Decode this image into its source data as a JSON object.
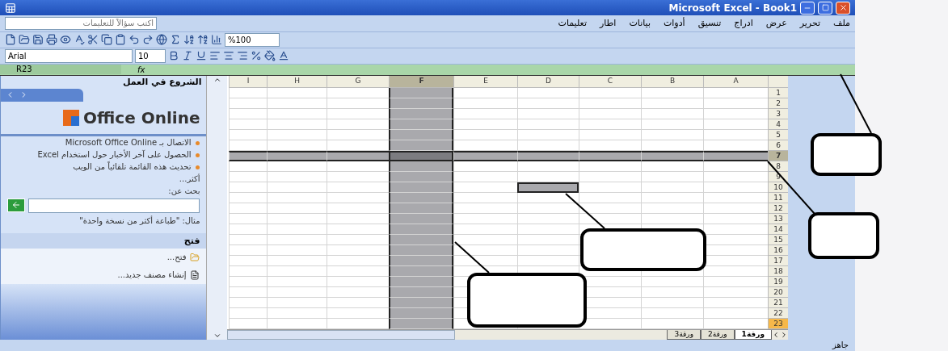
{
  "window": {
    "title": "Microsoft Excel - Book1"
  },
  "menu": {
    "items": [
      "ملف",
      "تحرير",
      "عرض",
      "ادراج",
      "تنسيق",
      "أدوات",
      "بيانات",
      "اطار",
      "تعليمات"
    ],
    "help_placeholder": "اكتب سؤالاً للتعليمات"
  },
  "standard_toolbar": {
    "zoom": "%100"
  },
  "formatting_toolbar": {
    "font": "Arial",
    "size": "10"
  },
  "formula_bar": {
    "name_box": "R23",
    "fx_label": "fx"
  },
  "task_pane": {
    "title": "الشروع في العمل",
    "logo_text": "Office Online",
    "links": [
      "الاتصال بـ Microsoft Office Online",
      "الحصول على آخر الأخبار حول استخدام Excel",
      "تحديث هذه القائمة تلقائياً من الويب"
    ],
    "more": "أكثر...",
    "search_label": "بحث عن:",
    "example": "مثال: \"طباعة أكثر من نسخة واحدة\"",
    "open_title": "فتح",
    "open_items": [
      "فتح...",
      "إنشاء مصنف جديد..."
    ]
  },
  "grid": {
    "columns": [
      {
        "label": "A",
        "selected": false
      },
      {
        "label": "B",
        "selected": false
      },
      {
        "label": "C",
        "selected": false
      },
      {
        "label": "D",
        "selected": false
      },
      {
        "label": "E",
        "selected": false
      },
      {
        "label": "F",
        "selected": true
      },
      {
        "label": "G",
        "selected": false
      },
      {
        "label": "H",
        "selected": false
      },
      {
        "label": "I",
        "selected": false
      }
    ],
    "rows": [
      {
        "label": "1",
        "selected": false
      },
      {
        "label": "2",
        "selected": false
      },
      {
        "label": "3",
        "selected": false
      },
      {
        "label": "4",
        "selected": false
      },
      {
        "label": "5",
        "selected": false
      },
      {
        "label": "6",
        "selected": false
      },
      {
        "label": "7",
        "selected": true
      },
      {
        "label": "8",
        "selected": false
      },
      {
        "label": "9",
        "selected": false
      },
      {
        "label": "10",
        "selected": false,
        "marked": [
          false,
          false,
          false,
          true,
          false,
          false,
          false,
          false,
          false
        ]
      },
      {
        "label": "11",
        "selected": false
      },
      {
        "label": "12",
        "selected": false
      },
      {
        "label": "13",
        "selected": false
      },
      {
        "label": "14",
        "selected": false
      },
      {
        "label": "15",
        "selected": false
      },
      {
        "label": "16",
        "selected": false
      },
      {
        "label": "17",
        "selected": false
      },
      {
        "label": "18",
        "selected": false
      },
      {
        "label": "19",
        "selected": false
      },
      {
        "label": "20",
        "selected": false
      },
      {
        "label": "21",
        "selected": false
      },
      {
        "label": "22",
        "selected": false
      },
      {
        "label": "23",
        "selected": false,
        "active": true
      }
    ]
  },
  "sheet_tabs": [
    {
      "label": "ورقة1",
      "selected": true
    },
    {
      "label": "ورقة2",
      "selected": false
    },
    {
      "label": "ورقة3",
      "selected": false
    }
  ],
  "status_bar": {
    "text": "جاهز"
  }
}
